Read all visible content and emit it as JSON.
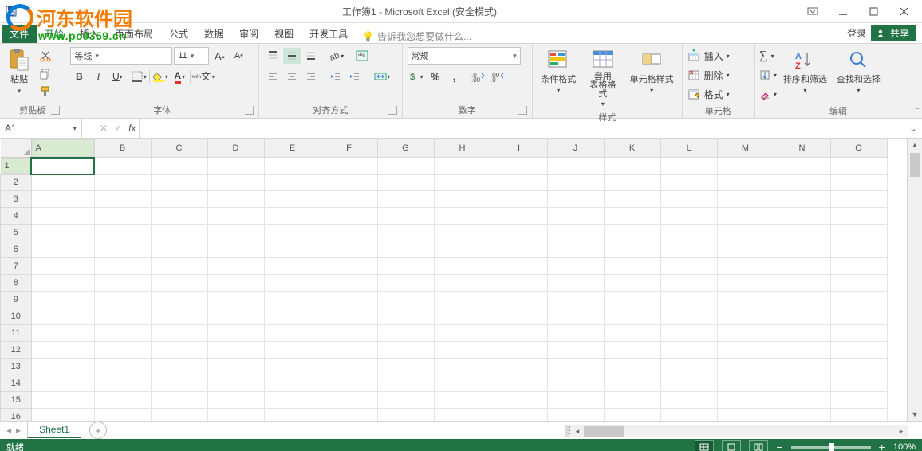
{
  "watermark": {
    "title": "河东软件园",
    "url": "www.pc0359.cn"
  },
  "window": {
    "title": "工作簿1 - Microsoft Excel (安全模式)"
  },
  "tabs": {
    "file": "文件",
    "list": [
      "开始",
      "插入",
      "页面布局",
      "公式",
      "数据",
      "审阅",
      "视图",
      "开发工具"
    ],
    "active": "开始",
    "tellme": "告诉我您想要做什么...",
    "login": "登录",
    "share": "共享"
  },
  "clipboard": {
    "paste": "粘贴",
    "label": "剪贴板"
  },
  "font": {
    "name": "等线",
    "size": "11",
    "label": "字体"
  },
  "align": {
    "label": "对齐方式"
  },
  "number": {
    "format": "常规",
    "label": "数字"
  },
  "styles": {
    "cond": "条件格式",
    "table": "套用\n表格格式",
    "cell": "单元格样式",
    "label": "样式"
  },
  "cells": {
    "insert": "插入",
    "delete": "删除",
    "format": "格式",
    "label": "单元格"
  },
  "editing": {
    "sort": "排序和筛选",
    "find": "查找和选择",
    "label": "编辑"
  },
  "namebox": "A1",
  "columns": [
    "A",
    "B",
    "C",
    "D",
    "E",
    "F",
    "G",
    "H",
    "I",
    "J",
    "K",
    "L",
    "M",
    "N",
    "O"
  ],
  "rows": 16,
  "activeCell": {
    "col": 0,
    "row": 0
  },
  "sheet": {
    "name": "Sheet1"
  },
  "status": {
    "ready": "就绪",
    "zoom": "100%"
  }
}
